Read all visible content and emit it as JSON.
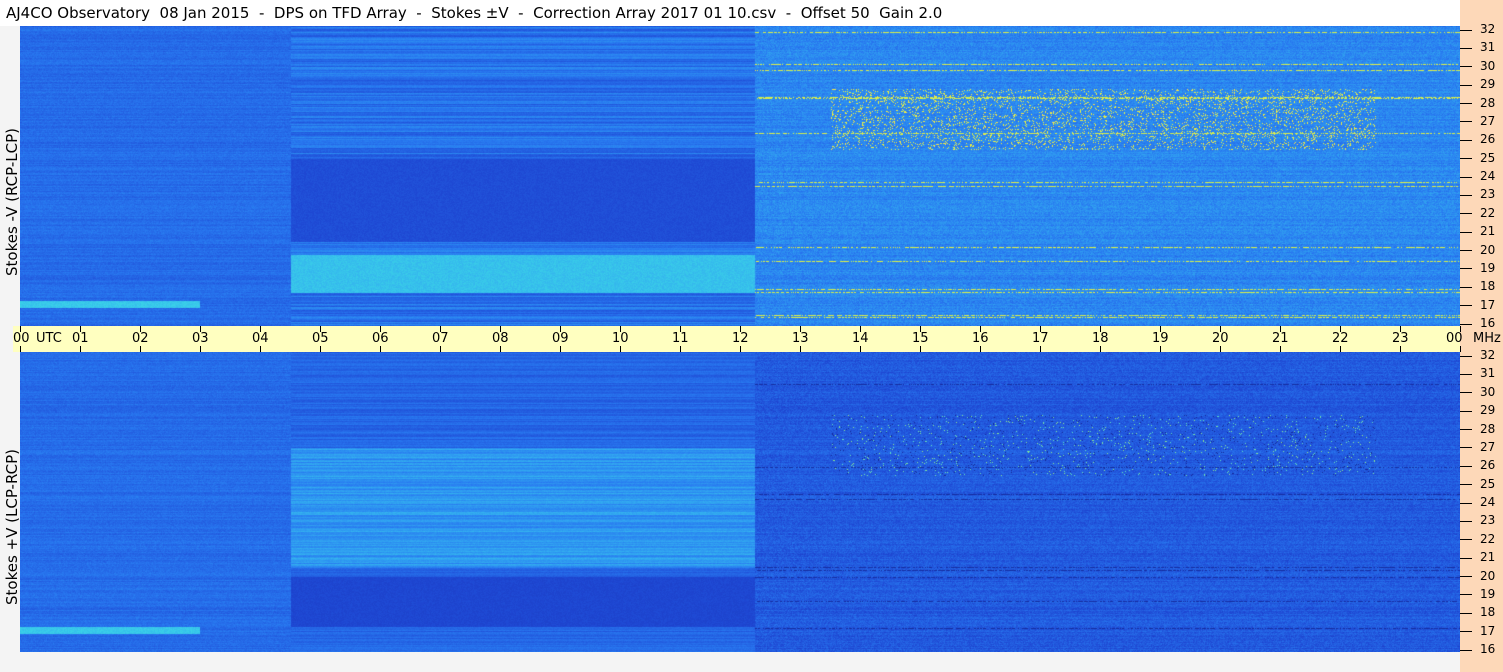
{
  "title": "AJ4CO Observatory  08 Jan 2015  -  DPS on TFD Array  -  Stokes ±V  -  Correction Array 2017 01 10.csv  -  Offset 50  Gain 2.0",
  "chart_data": [
    {
      "type": "heatmap",
      "panel": "top",
      "ylabel": "Stokes -V (RCP-LCP)",
      "x_unit": "UTC",
      "y_unit": "MHz",
      "xlim": [
        0,
        24
      ],
      "ylim": [
        16,
        32
      ],
      "x_ticks": [
        "00",
        "01",
        "02",
        "03",
        "04",
        "05",
        "06",
        "07",
        "08",
        "09",
        "10",
        "11",
        "12",
        "13",
        "14",
        "15",
        "16",
        "17",
        "18",
        "19",
        "20",
        "21",
        "22",
        "23",
        "00"
      ],
      "y_ticks": [
        "16",
        "17",
        "18",
        "19",
        "20",
        "21",
        "22",
        "23",
        "24",
        "25",
        "26",
        "27",
        "28",
        "29",
        "30",
        "31",
        "32"
      ]
    },
    {
      "type": "heatmap",
      "panel": "bottom",
      "ylabel": "Stokes +V (LCP-RCP)",
      "xlim": [
        0,
        24
      ],
      "ylim": [
        16,
        32
      ],
      "y_ticks": [
        "16",
        "17",
        "18",
        "19",
        "20",
        "21",
        "22",
        "23",
        "24",
        "25",
        "26",
        "27",
        "28",
        "29",
        "30",
        "31",
        "32"
      ]
    }
  ],
  "time_axis": {
    "utc_label": "UTC",
    "mhz_label": "MHz"
  },
  "colors": {
    "low": "#1a3cb8",
    "mid": "#2a78e8",
    "high": "#40d8e8",
    "rfi": "#f0f040",
    "rfi2": "#ff40ff",
    "time_band": "#ffffc0",
    "axis_panel": "#fdd8b8"
  }
}
